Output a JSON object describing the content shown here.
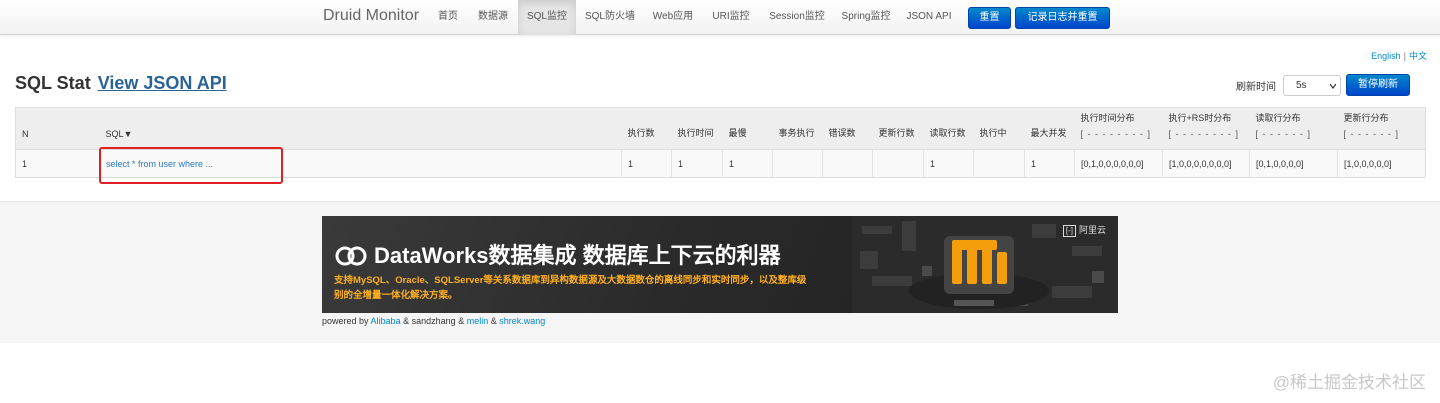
{
  "navbar": {
    "brand": "Druid Monitor",
    "items": [
      {
        "label": "首页"
      },
      {
        "label": "数据源"
      },
      {
        "label": "SQL监控",
        "active": true
      },
      {
        "label": "SQL防火墙"
      },
      {
        "label": "Web应用"
      },
      {
        "label": "URI监控"
      },
      {
        "label": "Session监控"
      },
      {
        "label": "Spring监控"
      },
      {
        "label": "JSON API"
      }
    ],
    "reset_label": "重置",
    "log_reset_label": "记录日志并重置"
  },
  "lang": {
    "english": "English",
    "separator": "|",
    "chinese": "中文"
  },
  "heading": {
    "title": "SQL Stat",
    "link": "View JSON API"
  },
  "refresh": {
    "label": "刷新时间",
    "selected": "5s",
    "pause_label": "暂停刷新"
  },
  "table": {
    "columns": [
      {
        "label": "N"
      },
      {
        "label": "SQL▼"
      },
      {
        "label": "执行数"
      },
      {
        "label": "执行时间"
      },
      {
        "label": "最慢"
      },
      {
        "label": "事务执行"
      },
      {
        "label": "错误数"
      },
      {
        "label": "更新行数"
      },
      {
        "label": "读取行数"
      },
      {
        "label": "执行中"
      },
      {
        "label": "最大并发"
      },
      {
        "label": "执行时间分布",
        "sub": "[ - - - - - - - - ]"
      },
      {
        "label": "执行+RS时分布",
        "sub": "[ - - - - - - - - ]"
      },
      {
        "label": "读取行分布",
        "sub": "[ - - - - - - ]"
      },
      {
        "label": "更新行分布",
        "sub": "[ - - - - - - ]"
      }
    ],
    "rows": [
      [
        "1",
        "select * from user where ...",
        "1",
        "1",
        "1",
        "",
        "",
        "",
        "1",
        "",
        "1",
        "[0,1,0,0,0,0,0,0]",
        "[1,0,0,0,0,0,0,0]",
        "[0,1,0,0,0,0]",
        "[1,0,0,0,0,0]"
      ]
    ]
  },
  "banner": {
    "title": "DataWorks数据集成 数据库上下云的利器",
    "description": "支持MySQL、Oracle、SQLServer等关系数据库到异构数据源及大数据数仓的离线同步和实时同步，以及整库级别的全增量一体化解决方案。",
    "brand_mark": "[-]",
    "brand": "阿里云"
  },
  "footer": {
    "prefix": "powered by",
    "alibaba": "Alibaba",
    "amp1": "&",
    "sandzhang": "sandzhang",
    "amp2": "&",
    "melin": "melin",
    "amp3": "&",
    "shrek": "shrek.wang"
  },
  "watermark": "@稀土掘金技术社区",
  "colors": {
    "accent": "#0088cc",
    "button": "#0055cc",
    "highlight": "#e02020",
    "banner_text": "#ffb020"
  }
}
